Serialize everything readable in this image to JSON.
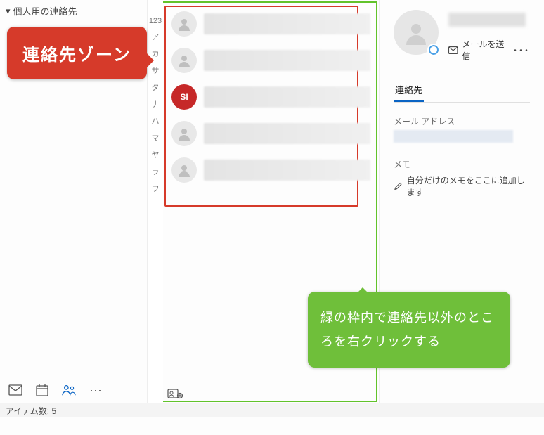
{
  "nav": {
    "folder_expand_glyph": "▾",
    "folder_title": "個人用の連絡先"
  },
  "index_rail": [
    "123",
    "ア",
    "カ",
    "サ",
    "タ",
    "ナ",
    "ハ",
    "マ",
    "ヤ",
    "ラ",
    "ワ"
  ],
  "contacts": {
    "avatar_initials_row3": "SI"
  },
  "detail": {
    "send_mail_label": "メールを送信",
    "more_glyph": "･･･",
    "tab_label": "連絡先",
    "email_label": "メール アドレス",
    "memo_label": "メモ",
    "memo_placeholder": "自分だけのメモをここに追加します"
  },
  "status": {
    "item_count_label": "アイテム数:  5"
  },
  "annotations": {
    "red_callout": "連絡先ゾーン",
    "green_callout": "緑の枠内で連絡先以外のところを右クリックする"
  }
}
